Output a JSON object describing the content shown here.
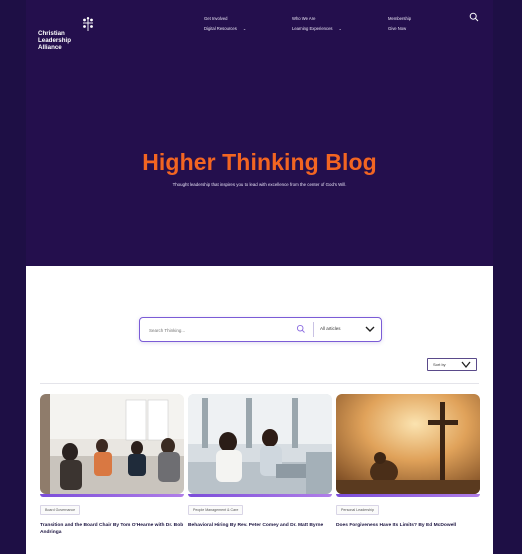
{
  "header": {
    "logo": {
      "lines": [
        "Christian",
        "Leadership",
        "Alliance"
      ]
    },
    "nav": [
      {
        "col": 1,
        "items": [
          {
            "label": "Get Involved",
            "dropdown": false
          },
          {
            "label": "Digital Resources",
            "dropdown": true
          }
        ]
      },
      {
        "col": 2,
        "items": [
          {
            "label": "Who We Are",
            "dropdown": false
          },
          {
            "label": "Learning Experiences",
            "dropdown": true
          }
        ]
      },
      {
        "col": 3,
        "items": [
          {
            "label": "Membership",
            "dropdown": false
          },
          {
            "label": "Give Now",
            "dropdown": false
          }
        ]
      }
    ]
  },
  "hero": {
    "title": "Higher Thinking Blog",
    "subtitle": "Thought leadership that inspires you to lead with excellence from the center of God's Will."
  },
  "search": {
    "placeholder": "Search Thinking...",
    "filter_value": "All articles"
  },
  "sort": {
    "label": "Sort by"
  },
  "cards": [
    {
      "tag": "Board Governance",
      "title": "Transition and the Board Chair By Tom O'Hearne with Dr. Bob Andringa"
    },
    {
      "tag": "People Management & Care",
      "title": "Behavioral Hiring By Rev. Peter Comey and Dr. Matt Byrne"
    },
    {
      "tag": "Personal Leadership",
      "title": "Does Forgiveness Have Its Limits? By Ed McDowell"
    }
  ],
  "colors": {
    "hero_bg": "#240f4d",
    "outer_bg": "#1e0f45",
    "accent_orange": "#f26522",
    "accent_purple": "#7b4dd9"
  },
  "icons": {
    "logo": "leaf-cross-icon",
    "search": "search-icon",
    "chevron": "chevron-down-icon"
  }
}
